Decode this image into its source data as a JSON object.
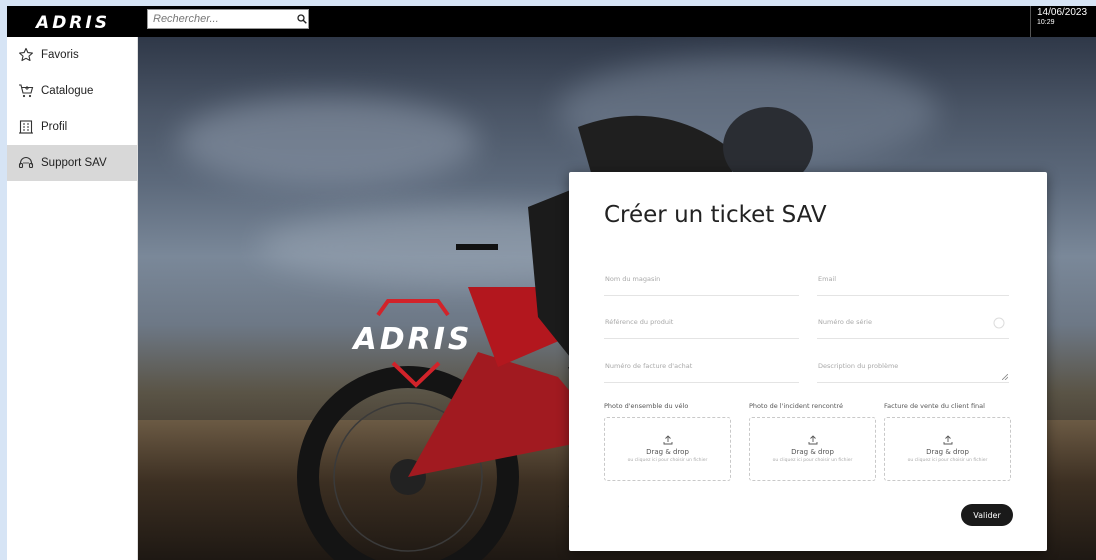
{
  "app": {
    "logo_text": "ADRIS"
  },
  "search": {
    "placeholder": "Rechercher..."
  },
  "datetime": {
    "date": "14/06/2023",
    "time": "10:29"
  },
  "sidebar": {
    "items": [
      {
        "label": "Favoris",
        "icon": "star-icon"
      },
      {
        "label": "Catalogue",
        "icon": "cart-icon"
      },
      {
        "label": "Profil",
        "icon": "building-icon"
      },
      {
        "label": "Support SAV",
        "icon": "headset-icon",
        "active": true
      }
    ]
  },
  "hero": {
    "brand_text": "ADRIS"
  },
  "form": {
    "title": "Créer un ticket SAV",
    "fields": {
      "store_name": "Nom du magasin",
      "email": "Email",
      "product_ref": "Référence du produit",
      "serial_number": "Numéro de série",
      "invoice_number": "Numéro de facture d'achat",
      "problem_description": "Description du problème"
    },
    "uploads": [
      {
        "label": "Photo d'ensemble du vélo",
        "main": "Drag & drop",
        "sub": "ou cliquez ici pour choisir un fichier"
      },
      {
        "label": "Photo de l'incident rencontré",
        "main": "Drag & drop",
        "sub": "ou cliquez ici pour choisir un fichier"
      },
      {
        "label": "Facture de vente du client final",
        "main": "Drag & drop",
        "sub": "ou cliquez ici pour choisir un fichier"
      }
    ],
    "submit_label": "Valider"
  },
  "colors": {
    "accent_red": "#d2232a",
    "topbar": "#000000",
    "button": "#1a1a1a"
  }
}
